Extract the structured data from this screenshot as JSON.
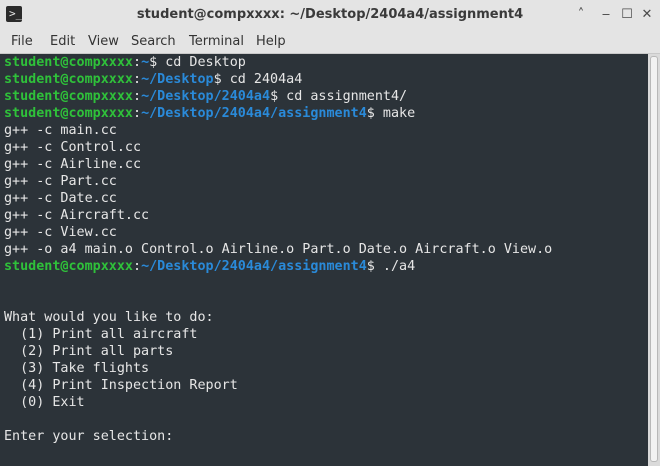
{
  "window": {
    "title": "student@compxxxx: ~/Desktop/2404a4/assignment4",
    "app_icon": "terminal-icon",
    "buttons": {
      "up": "˄",
      "minimize": "‒",
      "maximize": "☐",
      "close": "✕"
    }
  },
  "menubar": [
    "File",
    "Edit",
    "View",
    "Search",
    "Terminal",
    "Help"
  ],
  "colors": {
    "user": "#2fc13a",
    "path": "#2a8ad9",
    "text": "#e6e6e6",
    "background": "#2c3339"
  },
  "terminal": {
    "prompts": [
      {
        "user": "student@compxxxx",
        "sep": ":",
        "path": "~",
        "cmd": "$ cd Desktop"
      },
      {
        "user": "student@compxxxx",
        "sep": ":",
        "path": "~/Desktop",
        "cmd": "$ cd 2404a4"
      },
      {
        "user": "student@compxxxx",
        "sep": ":",
        "path": "~/Desktop/2404a4",
        "cmd": "$ cd assignment4/"
      },
      {
        "user": "student@compxxxx",
        "sep": ":",
        "path": "~/Desktop/2404a4/assignment4",
        "cmd": "$ make"
      },
      {
        "user": "student@compxxxx",
        "sep": ":",
        "path": "~/Desktop/2404a4/assignment4",
        "cmd": "$ ./a4"
      }
    ],
    "build_output": [
      "g++ -c main.cc",
      "g++ -c Control.cc",
      "g++ -c Airline.cc",
      "g++ -c Part.cc",
      "g++ -c Date.cc",
      "g++ -c Aircraft.cc",
      "g++ -c View.cc",
      "g++ -o a4 main.o Control.o Airline.o Part.o Date.o Aircraft.o View.o"
    ],
    "menu": {
      "heading": "What would you like to do:",
      "options": [
        "  (1) Print all aircraft",
        "  (2) Print all parts",
        "  (3) Take flights",
        "  (4) Print Inspection Report",
        "  (0) Exit"
      ],
      "input_prompt": "Enter your selection:"
    }
  }
}
